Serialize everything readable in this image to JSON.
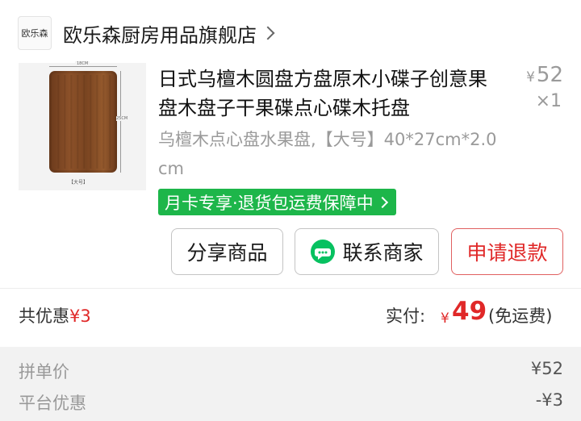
{
  "shop": {
    "logo_text": "欧乐森",
    "name": "欧乐森厨房用品旗舰店"
  },
  "product": {
    "title": "日式乌檀木圆盘方盘原木小碟子创意果盘木盘子干果碟点心碟木托盘",
    "price_currency": "¥",
    "price_value": "52",
    "quantity": "×1",
    "spec": "乌檀木点心盘水果盘,【大号】40*27cm*2.0cm",
    "promo": "月卡专享·退货包运费保障中",
    "image": {
      "dim_top": "18CM",
      "dim_side": "25CM",
      "size_label": "【大号】",
      "wood_color": "#8c5129"
    }
  },
  "actions": {
    "share_label": "分享商品",
    "contact_label": "联系商家",
    "refund_label": "申请退款"
  },
  "summary": {
    "discount_label": "共优惠",
    "discount_value": "¥3",
    "paid_label": "实付:",
    "paid_currency": "¥",
    "paid_amount": "49",
    "paid_note": "(免运费)"
  },
  "details": [
    {
      "label": "拼单价",
      "value": "¥52"
    },
    {
      "label": "平台优惠",
      "value": "-¥3"
    }
  ],
  "colors": {
    "accent_red": "#e02828",
    "promo_green": "#1db64a",
    "wechat_green": "#07c160"
  }
}
